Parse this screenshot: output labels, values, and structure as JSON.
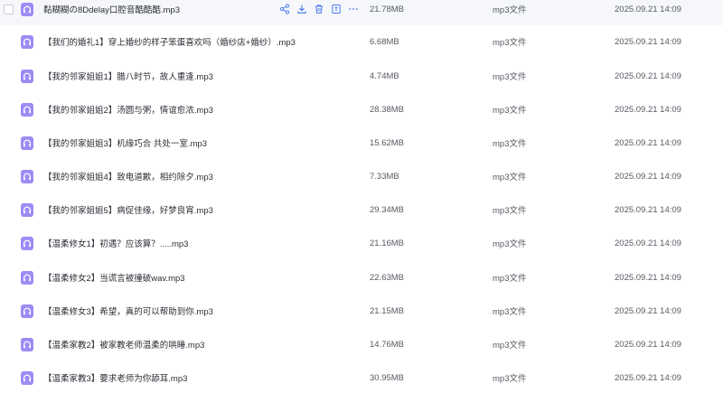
{
  "colors": {
    "accent": "#4a7cf0",
    "icon_bg": "#9b8cf5",
    "hover_bg": "#f6f7fb"
  },
  "row_actions": [
    {
      "name": "share-icon"
    },
    {
      "name": "download-icon"
    },
    {
      "name": "delete-icon"
    },
    {
      "name": "rename-icon"
    },
    {
      "name": "more-icon"
    }
  ],
  "files": [
    {
      "name": "黏糊糊の8Ddelay口腔音酷酷酷.mp3",
      "size": "21.78MB",
      "type": "mp3文件",
      "modified": "2025.09.21 14:09",
      "icon": "audio-file-icon",
      "hovered": true
    },
    {
      "name": "【我们的婚礼1】穿上婚纱的样子笨蛋喜欢吗（婚纱店+婚纱）.mp3",
      "size": "6.68MB",
      "type": "mp3文件",
      "modified": "2025.09.21 14:09",
      "icon": "audio-file-icon"
    },
    {
      "name": "【我的邻家姐姐1】腊八时节，故人重逢.mp3",
      "size": "4.74MB",
      "type": "mp3文件",
      "modified": "2025.09.21 14:09",
      "icon": "audio-file-icon"
    },
    {
      "name": "【我的邻家姐姐2】汤圆与粥，情谊愈浓.mp3",
      "size": "28.38MB",
      "type": "mp3文件",
      "modified": "2025.09.21 14:09",
      "icon": "audio-file-icon"
    },
    {
      "name": "【我的邻家姐姐3】机缘巧合 共处一室.mp3",
      "size": "15.62MB",
      "type": "mp3文件",
      "modified": "2025.09.21 14:09",
      "icon": "audio-file-icon"
    },
    {
      "name": "【我的邻家姐姐4】致电道歉，相约除夕.mp3",
      "size": "7.33MB",
      "type": "mp3文件",
      "modified": "2025.09.21 14:09",
      "icon": "audio-file-icon"
    },
    {
      "name": "【我的邻家姐姐5】病促佳缘，好梦良宵.mp3",
      "size": "29.34MB",
      "type": "mp3文件",
      "modified": "2025.09.21 14:09",
      "icon": "audio-file-icon"
    },
    {
      "name": "【温柔修女1】初遇？应该算？.....mp3",
      "size": "21.16MB",
      "type": "mp3文件",
      "modified": "2025.09.21 14:09",
      "icon": "audio-file-icon"
    },
    {
      "name": "【温柔修女2】当谎言被撞破wav.mp3",
      "size": "22.63MB",
      "type": "mp3文件",
      "modified": "2025.09.21 14:09",
      "icon": "audio-file-icon"
    },
    {
      "name": "【温柔修女3】希望，真的可以帮助到你.mp3",
      "size": "21.15MB",
      "type": "mp3文件",
      "modified": "2025.09.21 14:09",
      "icon": "audio-file-icon"
    },
    {
      "name": "【温柔家教2】被家教老师温柔的哄睡.mp3",
      "size": "14.76MB",
      "type": "mp3文件",
      "modified": "2025.09.21 14:09",
      "icon": "audio-file-icon"
    },
    {
      "name": "【温柔家教3】要求老师为你舔耳.mp3",
      "size": "30.95MB",
      "type": "mp3文件",
      "modified": "2025.09.21 14:09",
      "icon": "audio-file-icon"
    }
  ]
}
